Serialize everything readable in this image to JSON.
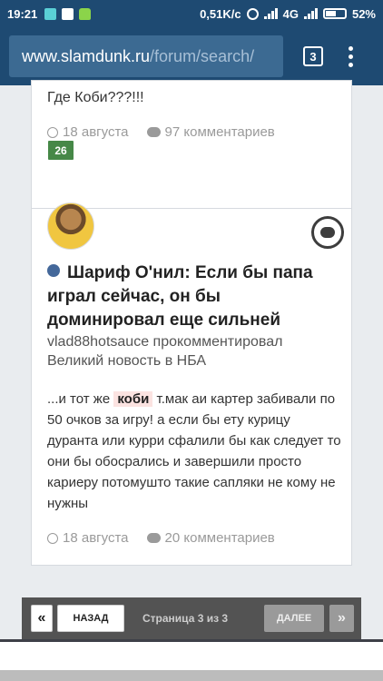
{
  "status_bar": {
    "time": "19:21",
    "network_speed": "0,51K/c",
    "network_type": "4G",
    "battery": "52%"
  },
  "browser": {
    "url_host": "www.slamdunk.ru",
    "url_path": "/forum/search/",
    "tab_count": "3"
  },
  "prev_result": {
    "text": "Где Коби???!!!",
    "date": "18 августа",
    "comments": "97 комментариев",
    "badge": "26"
  },
  "result": {
    "title": "Шариф О'нил: Если бы папа играл сейчас, он бы доминировал еще сильней",
    "subtitle": "vlad88hotsauce прокомментировал Великий новость в НБА",
    "body_before": "...и тот же",
    "highlight": "коби",
    "body_after": "т.мак аи картер забивали по 50 очков за игру! а если бы ету курицу дуранта или курри сфалили бы как следует то они бы обосрались и завершили просто кариеру потомушто такие сапляки не кому не нужны",
    "date": "18 августа",
    "comments": "20 комментариев"
  },
  "pagination": {
    "first_symbol": "«",
    "prev_label": "НАЗАД",
    "info": "Страница 3 из 3",
    "next_label": "ДАЛЕЕ",
    "last_symbol": "»"
  },
  "colors": {
    "toolbar": "#1e4a72",
    "badge": "#468847",
    "highlight": "#fbe3e1",
    "pager": "#535353"
  }
}
